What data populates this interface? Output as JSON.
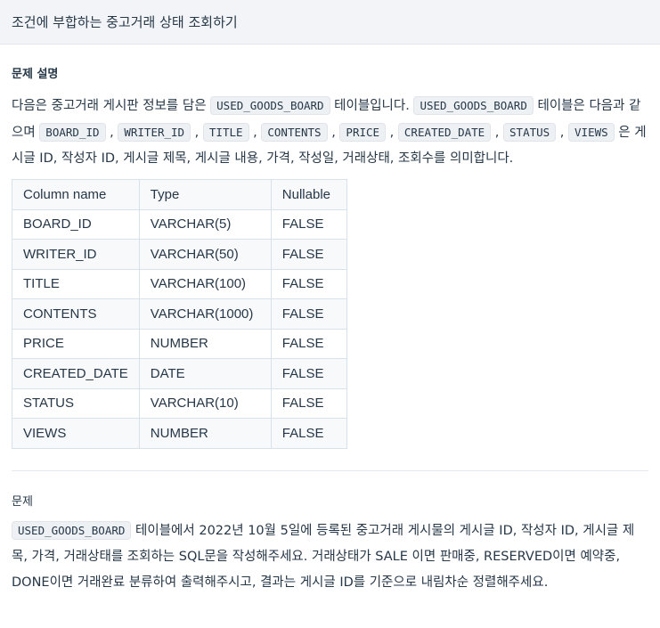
{
  "header": {
    "title": "조건에 부합하는 중고거래 상태 조회하기"
  },
  "description": {
    "label": "문제 설명",
    "text1": "다음은 중고거래 게시판 정보를 담은 ",
    "table_name": "USED_GOODS_BOARD",
    "text2": " 테이블입니다. ",
    "text3": " 테이블은 다음과 같으며 ",
    "columns": [
      "BOARD_ID",
      "WRITER_ID",
      "TITLE",
      "CONTENTS",
      "PRICE",
      "CREATED_DATE",
      "STATUS",
      "VIEWS"
    ],
    "sep": " , ",
    "text4": " 은 게시글 ID, 작성자 ID, 게시글 제목, 게시글 내용, 가격, 작성일, 거래상태, 조회수를 의미합니다."
  },
  "schema": {
    "headers": [
      "Column name",
      "Type",
      "Nullable"
    ],
    "rows": [
      [
        "BOARD_ID",
        "VARCHAR(5)",
        "FALSE"
      ],
      [
        "WRITER_ID",
        "VARCHAR(50)",
        "FALSE"
      ],
      [
        "TITLE",
        "VARCHAR(100)",
        "FALSE"
      ],
      [
        "CONTENTS",
        "VARCHAR(1000)",
        "FALSE"
      ],
      [
        "PRICE",
        "NUMBER",
        "FALSE"
      ],
      [
        "CREATED_DATE",
        "DATE",
        "FALSE"
      ],
      [
        "STATUS",
        "VARCHAR(10)",
        "FALSE"
      ],
      [
        "VIEWS",
        "NUMBER",
        "FALSE"
      ]
    ]
  },
  "problem": {
    "label": "문제",
    "table_name": "USED_GOODS_BOARD",
    "text": " 테이블에서 2022년 10월 5일에 등록된 중고거래 게시물의 게시글 ID, 작성자 ID, 게시글 제목, 가격, 거래상태를 조회하는 SQL문을 작성해주세요. 거래상태가 SALE 이면 판매중, RESERVED이면 예약중, DONE이면 거래완료 분류하여 출력해주시고, 결과는 게시글 ID를 기준으로 내림차순 정렬해주세요."
  }
}
